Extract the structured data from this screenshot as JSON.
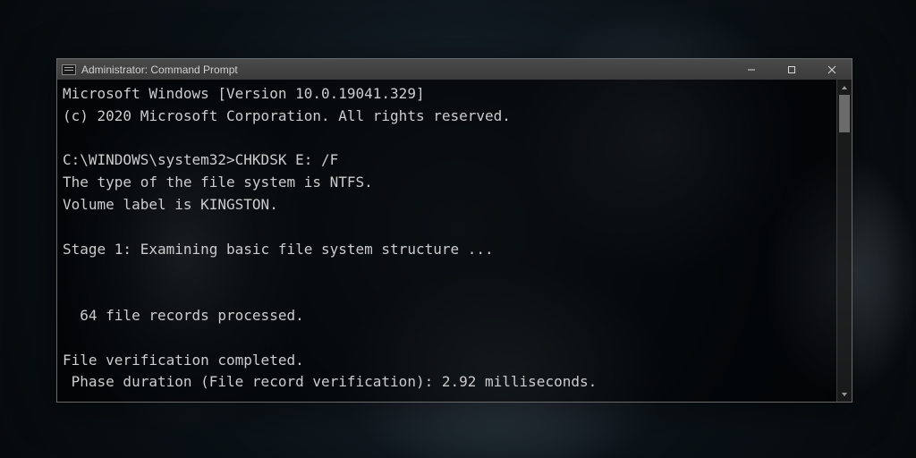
{
  "window": {
    "title": "Administrator: Command Prompt",
    "controls": {
      "minimize": "Minimize",
      "maximize": "Maximize",
      "close": "Close"
    }
  },
  "console": {
    "lines": [
      "Microsoft Windows [Version 10.0.19041.329]",
      "(c) 2020 Microsoft Corporation. All rights reserved.",
      "",
      "C:\\WINDOWS\\system32>CHKDSK E: /F",
      "The type of the file system is NTFS.",
      "Volume label is KINGSTON.",
      "",
      "Stage 1: Examining basic file system structure ...",
      "",
      "",
      "  64 file records processed.",
      "",
      "File verification completed.",
      " Phase duration (File record verification): 2.92 milliseconds."
    ]
  }
}
